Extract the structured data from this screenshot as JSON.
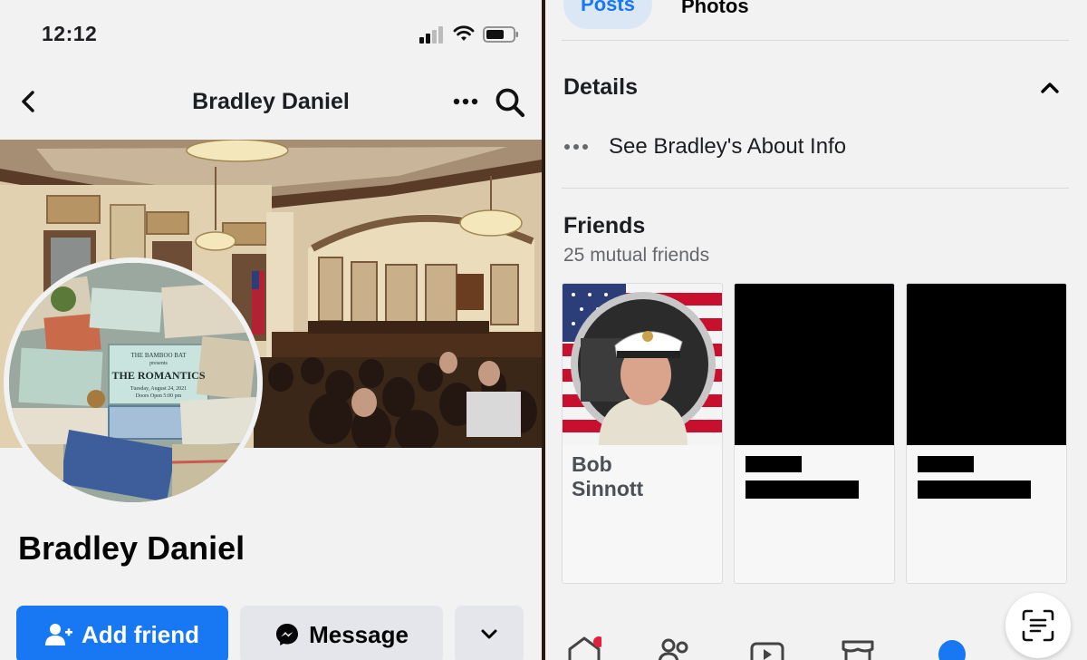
{
  "status_bar": {
    "time": "12:12"
  },
  "nav": {
    "title": "Bradley Daniel"
  },
  "profile": {
    "name": "Bradley Daniel",
    "add_friend_label": "Add friend",
    "message_label": "Message"
  },
  "poster": {
    "line1": "THE BAMBOO BAT",
    "line2": "presents",
    "headline": "THE ROMANTICS",
    "line3": "Tuesday, August 24, 2021",
    "line4": "Doors Open 5:00 pm"
  },
  "tabs": {
    "posts": "Posts",
    "photos": "Photos"
  },
  "details": {
    "title": "Details",
    "about_label": "See Bradley's About Info"
  },
  "friends": {
    "title": "Friends",
    "subtitle": "25 mutual friends",
    "items": [
      {
        "name": "Bob\nSinnott",
        "redacted": false
      },
      {
        "name": "",
        "redacted": true
      },
      {
        "name": "",
        "redacted": true
      }
    ]
  },
  "colors": {
    "accent": "#1877f2",
    "button_gray": "#e4e6eb",
    "notification": "#e41e3f"
  },
  "icons": [
    "back-icon",
    "more-icon",
    "search-icon",
    "add-person-icon",
    "messenger-icon",
    "chevron-down-icon",
    "chevron-up-icon",
    "dots-icon",
    "home-icon",
    "friends-icon",
    "video-icon",
    "marketplace-icon",
    "profile-icon",
    "scan-icon"
  ]
}
